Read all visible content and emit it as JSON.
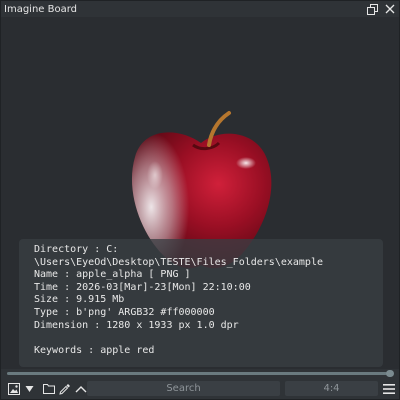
{
  "window": {
    "title": "Imagine Board",
    "restore_icon": "restore-icon",
    "close_icon": "close-icon"
  },
  "viewer": {
    "image_subject": "apple"
  },
  "info": {
    "directory_label": "Directory : C:",
    "directory_path": "\\Users\\EyeOd\\Desktop\\TESTE\\Files_Folders\\example",
    "name": "Name : apple_alpha [ PNG ]",
    "time": "Time : 2026-03[Mar]-23[Mon] 22:10:00",
    "size": "Size : 9.915 Mb",
    "type": "Type : b'png' ARGB32 #ff000000",
    "dimension": "Dimension : 1280 x 1933 px  1.0 dpr",
    "keywords": "Keywords : apple red"
  },
  "toolbar": {
    "search_placeholder": "Search",
    "ratio_label": "4:4",
    "icons": [
      "image-icon",
      "dropdown-arrow-icon",
      "folder-icon",
      "eyedropper-icon",
      "chevron-up-icon",
      "hamburger-menu-icon"
    ]
  },
  "colors": {
    "background": "#2a2d31",
    "panel": "#383d42",
    "text": "#e8e8e8",
    "accent_track": "#6a7a7f"
  }
}
